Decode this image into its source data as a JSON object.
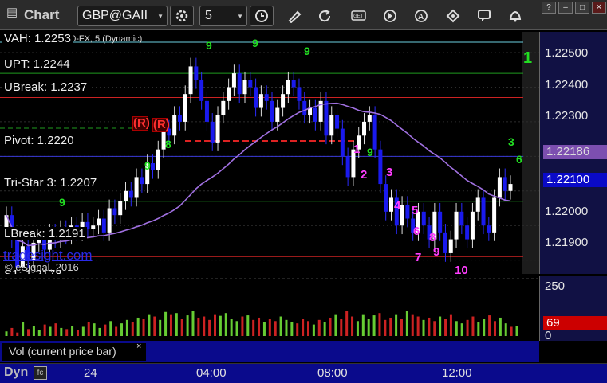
{
  "window": {
    "title": "Chart"
  },
  "toolbar": {
    "symbol": "GBP@GAII",
    "interval": "5",
    "icons": [
      "settings-gear-icon",
      "clock-icon",
      "pencil-icon",
      "refresh-icon",
      "get-icon",
      "play-icon",
      "text-a-icon",
      "tag-icon",
      "comment-icon",
      "bell-icon"
    ]
  },
  "study_title": "GBP@GAIN A0-FX, 5 (Dynamic)",
  "levels": [
    {
      "label": "VAH: 1.2253",
      "price": 1.2253,
      "color": "#6dd0e0"
    },
    {
      "label": "UPT: 1.2244",
      "price": 1.2244,
      "color": "#1f9b1f"
    },
    {
      "label": "UBreak: 1.2237",
      "price": 1.2237,
      "color": "#cc2222"
    },
    {
      "label": "Pivot: 1.2220",
      "price": 1.222,
      "color": "#3a3ad8"
    },
    {
      "label": "Tri-Star 3: 1.2207",
      "price": 1.2207,
      "color": "#1f9b1f"
    },
    {
      "label": "LBreak: 1.2191",
      "price": 1.2191,
      "color": "#cc2222"
    },
    {
      "label": "S1: 1.2178",
      "price": 1.2178,
      "color": "#cfcfcf"
    }
  ],
  "price_axis": {
    "ticks": [
      "1.22500",
      "1.22400",
      "1.22300",
      "1.22200",
      "1.22100",
      "1.22000",
      "1.21900"
    ],
    "ma_badge": {
      "value": "1.22186",
      "color": "#7c4fb0"
    },
    "last_badge": {
      "value": "1.22100",
      "color": "#0a0ac8"
    }
  },
  "annotations": {
    "countdown": [
      "1",
      "2",
      "3",
      "4",
      "5",
      "6",
      "7",
      "8",
      "9",
      "10"
    ],
    "setup_marks": [
      "(R)",
      "(R)"
    ],
    "green_digits": [
      "1",
      "3",
      "6",
      "9",
      "9",
      "9",
      "9",
      "9",
      "9",
      "8"
    ]
  },
  "watermark": "tradesight.com",
  "copyright": "© eSignal, 2016",
  "volume_panel": {
    "label": "Vol (current price bar)",
    "close_glyph": "×",
    "axis_ticks": [
      "250",
      "0"
    ],
    "current": "69",
    "current_color": "#cc0000"
  },
  "time_axis": {
    "mode": "Dyn",
    "labels": [
      "24",
      "04:00",
      "08:00",
      "12:00"
    ]
  },
  "colors": {
    "up_candle": "#ffffff",
    "down_candle": "#1a1aee",
    "ma_line": "#a070e0",
    "vol_up": "#66cc33",
    "vol_down": "#cc2222"
  },
  "chart_data": {
    "type": "candlestick",
    "ylim": [
      1.2186,
      1.2256
    ],
    "closes": [
      1.2203,
      1.2196,
      1.2188,
      1.2194,
      1.219,
      1.2195,
      1.2197,
      1.2193,
      1.2198,
      1.2196,
      1.2199,
      1.2197,
      1.22,
      1.2198,
      1.2201,
      1.2199,
      1.22,
      1.2202,
      1.2198,
      1.2205,
      1.2203,
      1.2207,
      1.221,
      1.2208,
      1.2214,
      1.2212,
      1.2218,
      1.2216,
      1.2222,
      1.2228,
      1.2226,
      1.2232,
      1.223,
      1.2238,
      1.2246,
      1.2242,
      1.2236,
      1.223,
      1.2224,
      1.2232,
      1.2236,
      1.224,
      1.2244,
      1.2238,
      1.2242,
      1.224,
      1.2234,
      1.2238,
      1.2236,
      1.223,
      1.2234,
      1.2238,
      1.2242,
      1.224,
      1.2236,
      1.2232,
      1.2234,
      1.223,
      1.2236,
      1.2226,
      1.2232,
      1.2228,
      1.222,
      1.2214,
      1.2222,
      1.2226,
      1.223,
      1.2232,
      1.2222,
      1.2212,
      1.2204,
      1.2208,
      1.22,
      1.2206,
      1.2202,
      1.2198,
      1.2204,
      1.22,
      1.2196,
      1.2204,
      1.2198,
      1.2192,
      1.2196,
      1.2204,
      1.22,
      1.2196,
      1.2204,
      1.2208,
      1.22,
      1.2198,
      1.2208,
      1.2214,
      1.221,
      1.2212
    ],
    "volumes": [
      20,
      35,
      15,
      60,
      30,
      45,
      25,
      50,
      40,
      55,
      35,
      30,
      45,
      25,
      40,
      60,
      55,
      35,
      50,
      65,
      40,
      55,
      70,
      60,
      80,
      75,
      95,
      85,
      70,
      105,
      95,
      100,
      75,
      90,
      110,
      80,
      85,
      70,
      95,
      88,
      100,
      75,
      65,
      85,
      90,
      70,
      80,
      60,
      75,
      65,
      85,
      70,
      60,
      55,
      75,
      65,
      50,
      70,
      60,
      80,
      95,
      75,
      110,
      85,
      65,
      95,
      75,
      90,
      100,
      70,
      80,
      95,
      75,
      110,
      95,
      85,
      70,
      80,
      65,
      85,
      75,
      95,
      65,
      55,
      70,
      85,
      60,
      75,
      90,
      65,
      80,
      55,
      40,
      45
    ]
  }
}
